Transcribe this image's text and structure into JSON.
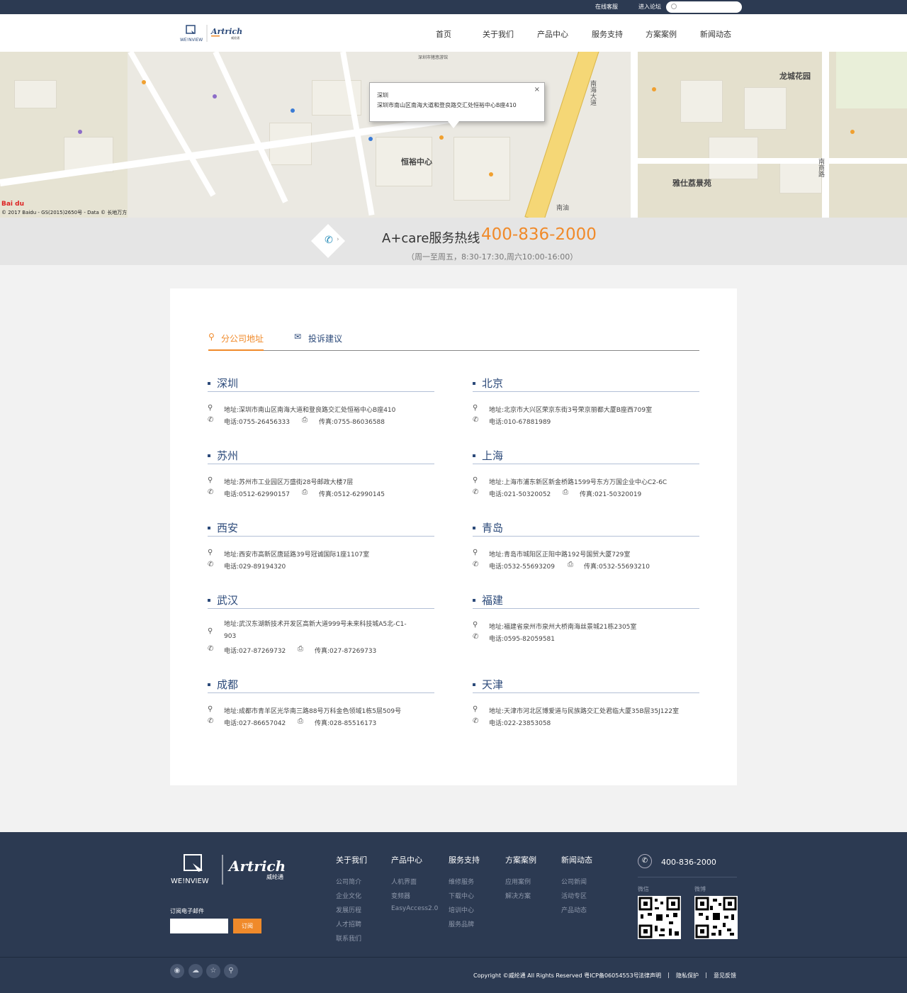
{
  "topbar": {
    "online_service": "在线客服",
    "forum": "进入论坛",
    "search_placeholder": ""
  },
  "brand": {
    "logo_left": "WE!NVIEW",
    "logo_right": "Artrich",
    "logo_right_sub": "威纶通"
  },
  "nav": {
    "items": [
      "首页",
      "关于我们",
      "产品中心",
      "服务支持",
      "方案案例",
      "新闻动态"
    ]
  },
  "map": {
    "popup_city": "深圳",
    "popup_address": "深圳市南山区南海大道和登良路交汇处恒裕中心B座410",
    "copyright": "© 2017 Baidu - GS(2015)2650号 - Data © 长地万方",
    "labels": {
      "hengyu": "恒裕中心",
      "longcheng": "龙城花园",
      "yashi": "雅仕荔景苑",
      "nanhai": "南海大道",
      "nantou": "南头",
      "nanshan_road": "南商路",
      "nanyou": "南油",
      "shenzhen_hall": "深圳市猪悠游馆"
    }
  },
  "hotline": {
    "label": "A+care服务热线",
    "number": "400-836-2000",
    "hours": "（周一至周五，8:30-17:30,周六10:00-16:00）"
  },
  "tabs": {
    "branch": "分公司地址",
    "complaint": "投诉建议"
  },
  "offices": [
    {
      "city": "深圳",
      "address": "地址:深圳市南山区南海大道和登良路交汇处恒裕中心B座410",
      "phone": "电话:0755-26456333",
      "fax": "传真:0755-86036588"
    },
    {
      "city": "北京",
      "address": "地址:北京市大兴区荣京东街3号荣京丽都大厦B座西709室",
      "phone": "电话:010-67881989",
      "fax": ""
    },
    {
      "city": "苏州",
      "address": "地址:苏州市工业园区万盛街28号邮政大楼7层",
      "phone": "电话:0512-62990157",
      "fax": "传真:0512-62990145"
    },
    {
      "city": "上海",
      "address": "地址:上海市浦东新区新金桥路1599号东方万国企业中心C2-6C",
      "phone": "电话:021-50320052",
      "fax": "传真:021-50320019"
    },
    {
      "city": "西安",
      "address": "地址:西安市高新区唐延路39号冠诚国际1座1107室",
      "phone": "电话:029-89194320",
      "fax": ""
    },
    {
      "city": "青岛",
      "address": "地址:青岛市城阳区正阳中路192号国贸大厦729室",
      "phone": "电话:0532-55693209",
      "fax": "传真:0532-55693210"
    },
    {
      "city": "武汉",
      "address": "地址:武汉东湖新技术开发区高新大道999号未来科技城A5北-C1-903",
      "phone": "电话:027-87269732",
      "fax": "传真:027-87269733"
    },
    {
      "city": "福建",
      "address": "地址:福建省泉州市泉州大桥南海丝景城21栋2305室",
      "phone": "电话:0595-82059581",
      "fax": ""
    },
    {
      "city": "成都",
      "address": "地址:成都市青羊区光华南三路88号万科金色领域1栋5层509号",
      "phone": "电话:027-86657042",
      "fax": "传真:028-85516173"
    },
    {
      "city": "天津",
      "address": "地址:天津市河北区博爱道与民族路交汇处君临大厦35B层35J122室",
      "phone": "电话:022-23853058",
      "fax": ""
    }
  ],
  "footer": {
    "logo_left": "WE!NVIEW",
    "logo_right": "Artrich",
    "logo_right_sub": "威纶通",
    "subscribe_label": "订阅电子邮件",
    "subscribe_button": "订阅",
    "columns": [
      {
        "head": "关于我们",
        "items": [
          "公司简介",
          "企业文化",
          "发展历程",
          "人才招聘",
          "联系我们"
        ]
      },
      {
        "head": "产品中心",
        "items": [
          "人机界面",
          "变频器",
          "EasyAccess2.0"
        ]
      },
      {
        "head": "服务支持",
        "items": [
          "维修服务",
          "下载中心",
          "培训中心",
          "服务品牌"
        ]
      },
      {
        "head": "方案案例",
        "items": [
          "应用案例",
          "解决方案"
        ]
      },
      {
        "head": "新闻动态",
        "items": [
          "公司新闻",
          "活动专区",
          "产品动态"
        ]
      }
    ],
    "phone": "400-836-2000",
    "qr_wechat": "微信",
    "qr_weibo": "微博",
    "copyright": "Copyright ©威纶通 All Rights Reserved 粤ICP备06054553号",
    "links": [
      "法律声明",
      "隐私保护",
      "意见反馈"
    ]
  },
  "colors": {
    "navy": "#2c3a52",
    "accent": "#f08a2a",
    "title_blue": "#2c4a7a"
  }
}
